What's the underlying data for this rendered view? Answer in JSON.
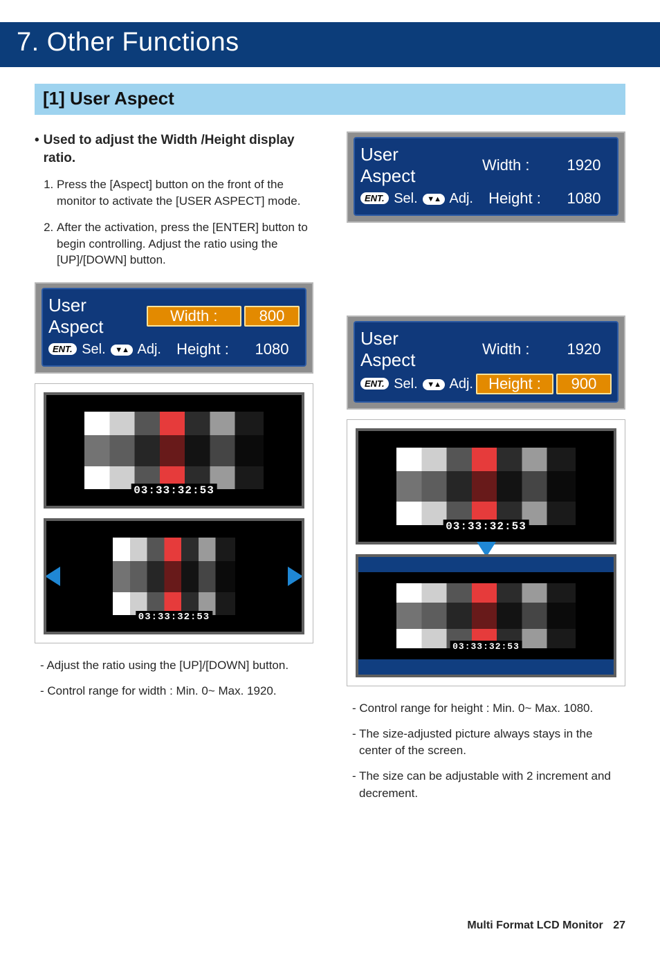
{
  "title": "7. Other Functions",
  "section": "[1] User Aspect",
  "bullet": "Used to adjust the Width /Height display ratio.",
  "steps": [
    "Press the [Aspect] button on the front of the monitor to activate the [USER ASPECT] mode.",
    "After the activation, press the [ENTER] button to begin controlling. Adjust the ratio using the [UP]/[DOWN] button."
  ],
  "osd": {
    "title": "User Aspect",
    "width_label": "Width :",
    "height_label": "Height :",
    "sel_label": "Sel.",
    "adj_label": "Adj.",
    "ent": "ENT.",
    "updown": "▼▲",
    "panels": {
      "topright": {
        "width": "1920",
        "height": "1080",
        "highlight": "none"
      },
      "left": {
        "width": "800",
        "height": "1080",
        "highlight": "width"
      },
      "right": {
        "width": "1920",
        "height": "900",
        "highlight": "height"
      }
    }
  },
  "timecode": "03:33:32:53",
  "notes_left": [
    "- Adjust the ratio using the [UP]/[DOWN] button.",
    "- Control range for width : Min. 0~ Max. 1920."
  ],
  "notes_right": [
    "- Control range for height : Min. 0~ Max. 1080.",
    "- The size-adjusted picture always stays in the center of the screen.",
    "- The size can be adjustable with 2 increment and decrement."
  ],
  "footer": {
    "title": "Multi Format LCD Monitor",
    "page": "27"
  }
}
